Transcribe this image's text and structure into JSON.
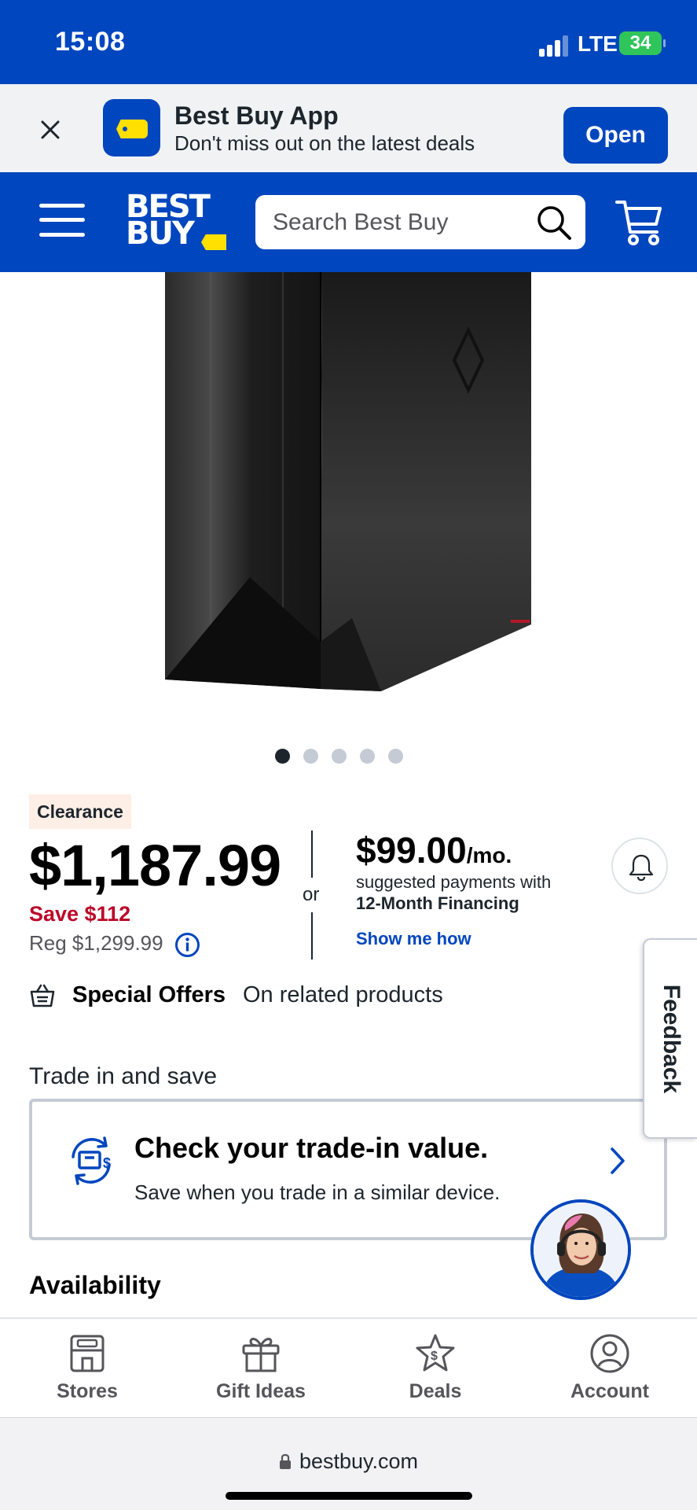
{
  "status_bar": {
    "time": "15:08",
    "network": "LTE",
    "battery": "34"
  },
  "app_banner": {
    "title": "Best Buy App",
    "subtitle": "Don't miss out on the latest deals",
    "open_label": "Open"
  },
  "header": {
    "logo_line1": "BEST",
    "logo_line2": "BUY",
    "search_placeholder": "Search Best Buy"
  },
  "gallery": {
    "image_count": 5,
    "active_index": 0
  },
  "product": {
    "badge": "Clearance",
    "price": "$1,187.99",
    "save": "Save $112",
    "regular": "Reg $1,299.99",
    "or": "or",
    "monthly_amount": "$99.00",
    "monthly_unit": "/mo.",
    "suggested": "suggested payments with",
    "financing": "12-Month Financing",
    "show_me_how": "Show me how"
  },
  "offers": {
    "label": "Special Offers",
    "text": "On related products"
  },
  "trade_in": {
    "heading": "Trade in and save",
    "title": "Check your trade-in value.",
    "subtitle": "Save when you trade in a similar device."
  },
  "feedback_label": "Feedback",
  "availability_heading": "Availability",
  "bottom_nav": [
    {
      "label": "Stores",
      "icon": "store-icon"
    },
    {
      "label": "Gift Ideas",
      "icon": "gift-icon"
    },
    {
      "label": "Deals",
      "icon": "deals-star-icon"
    },
    {
      "label": "Account",
      "icon": "account-icon"
    }
  ],
  "url": "bestbuy.com",
  "colors": {
    "brand_blue": "#0046be",
    "brand_yellow": "#ffe000",
    "sale_red": "#bb0628",
    "clearance_bg": "#fdeee6"
  }
}
